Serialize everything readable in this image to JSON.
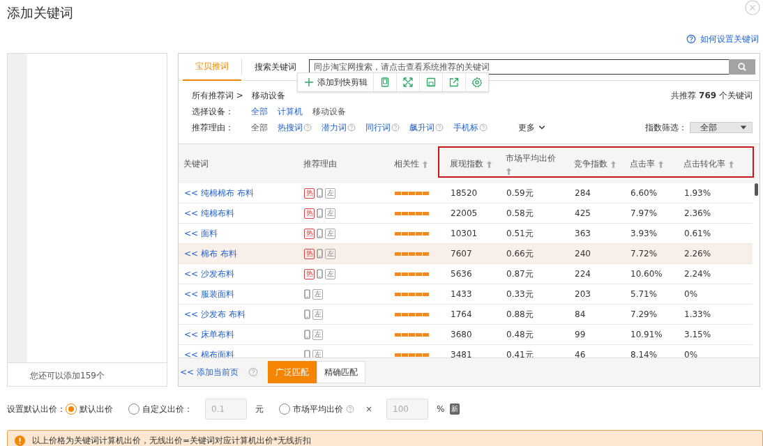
{
  "dialog": {
    "title": "添加关键词",
    "help_link": "如何设置关键词"
  },
  "left_panel": {
    "remaining_text": "您还可以添加159个"
  },
  "tabs": [
    {
      "label": "宝贝推词",
      "selected": true
    },
    {
      "label": "搜索关键词",
      "selected": false
    }
  ],
  "search": {
    "placeholder": "同步淘宝网搜索，请点击查看系统推荐的关键词"
  },
  "toolbar": {
    "add_label": "添加到快剪辑"
  },
  "breadcrumb": {
    "root": "所有推荐词 >",
    "current": "移动设备"
  },
  "total": {
    "prefix": "共推荐",
    "count": "769",
    "suffix": "个关键词"
  },
  "device_filter": {
    "label": "选择设备：",
    "options": [
      {
        "label": "全部",
        "selected": false
      },
      {
        "label": "计算机",
        "selected": false
      },
      {
        "label": "移动设备",
        "selected": true
      }
    ]
  },
  "reason_filter": {
    "label": "推荐理由：",
    "options": [
      {
        "label": "全部",
        "selected": true,
        "help": false
      },
      {
        "label": "热搜词",
        "selected": false,
        "help": true
      },
      {
        "label": "潜力词",
        "selected": false,
        "help": true
      },
      {
        "label": "同行词",
        "selected": false,
        "help": true
      },
      {
        "label": "飙升词",
        "selected": false,
        "help": true
      },
      {
        "label": "手机标",
        "selected": false,
        "help": true
      }
    ],
    "more": "更多"
  },
  "index_filter": {
    "label": "指数筛选：",
    "value": "全部"
  },
  "table": {
    "columns": [
      {
        "label": "关键词",
        "sortable": false,
        "highlighted": false
      },
      {
        "label": "推荐理由",
        "sortable": false,
        "highlighted": false
      },
      {
        "label": "相关性",
        "sortable": true,
        "highlighted": false
      },
      {
        "label": "展现指数",
        "sortable": true,
        "highlighted": true
      },
      {
        "label": "市场平均出价",
        "sortable": true,
        "highlighted": true
      },
      {
        "label": "竞争指数",
        "sortable": true,
        "highlighted": true
      },
      {
        "label": "点击率",
        "sortable": true,
        "highlighted": true
      },
      {
        "label": "点击转化率",
        "sortable": true,
        "highlighted": true
      }
    ],
    "rows": [
      {
        "keyword": "<< 纯棉棉布 布料",
        "tags": [
          {
            "kind": "hot",
            "text": "热"
          },
          {
            "kind": "mobile"
          },
          {
            "kind": "left",
            "text": "左"
          }
        ],
        "relevance": {
          "level": 1
        },
        "impressions": "18520",
        "avg_price": "0.59元",
        "competition": "284",
        "ctr": "6.60%",
        "cvr": "1.93%",
        "selected": false
      },
      {
        "keyword": "<< 纯棉布料",
        "tags": [
          {
            "kind": "hot",
            "text": "热"
          },
          {
            "kind": "mobile"
          },
          {
            "kind": "left",
            "text": "左"
          }
        ],
        "relevance": {
          "level": 1
        },
        "impressions": "22005",
        "avg_price": "0.58元",
        "competition": "425",
        "ctr": "7.97%",
        "cvr": "2.36%",
        "selected": false
      },
      {
        "keyword": "<< 面料",
        "tags": [
          {
            "kind": "hot",
            "text": "热"
          },
          {
            "kind": "mobile"
          },
          {
            "kind": "left",
            "text": "左"
          }
        ],
        "relevance": {
          "level": 1
        },
        "impressions": "10301",
        "avg_price": "0.51元",
        "competition": "363",
        "ctr": "3.93%",
        "cvr": "0.61%",
        "selected": false
      },
      {
        "keyword": "<< 棉布 布料",
        "tags": [
          {
            "kind": "hot",
            "text": "热"
          },
          {
            "kind": "mobile"
          },
          {
            "kind": "left",
            "text": "左"
          }
        ],
        "relevance": {
          "level": 1
        },
        "impressions": "7607",
        "avg_price": "0.66元",
        "competition": "240",
        "ctr": "7.72%",
        "cvr": "2.26%",
        "selected": true
      },
      {
        "keyword": "<< 沙发布料",
        "tags": [
          {
            "kind": "hot",
            "text": "热"
          },
          {
            "kind": "mobile"
          },
          {
            "kind": "left",
            "text": "左"
          }
        ],
        "relevance": {
          "level": 1
        },
        "impressions": "5636",
        "avg_price": "0.87元",
        "competition": "224",
        "ctr": "10.60%",
        "cvr": "2.24%",
        "selected": false
      },
      {
        "keyword": "<< 服装面料",
        "tags": [
          {
            "kind": "mobile"
          },
          {
            "kind": "left",
            "text": "左"
          }
        ],
        "relevance": {
          "level": 1
        },
        "impressions": "1433",
        "avg_price": "0.33元",
        "competition": "203",
        "ctr": "5.71%",
        "cvr": "0%",
        "selected": false
      },
      {
        "keyword": "<< 沙发布 布料",
        "tags": [
          {
            "kind": "mobile"
          },
          {
            "kind": "left",
            "text": "左"
          }
        ],
        "relevance": {
          "level": 1
        },
        "impressions": "1764",
        "avg_price": "0.88元",
        "competition": "84",
        "ctr": "7.29%",
        "cvr": "1.33%",
        "selected": false
      },
      {
        "keyword": "<< 床单布料",
        "tags": [
          {
            "kind": "mobile"
          },
          {
            "kind": "left",
            "text": "左"
          }
        ],
        "relevance": {
          "level": 1
        },
        "impressions": "3680",
        "avg_price": "0.48元",
        "competition": "99",
        "ctr": "10.91%",
        "cvr": "3.15%",
        "selected": false
      },
      {
        "keyword": "<< 棉布面料",
        "tags": [
          {
            "kind": "mobile"
          },
          {
            "kind": "left",
            "text": "左"
          }
        ],
        "relevance": {
          "level": 1
        },
        "impressions": "3481",
        "avg_price": "0.41元",
        "competition": "46",
        "ctr": "8.14%",
        "cvr": "0%",
        "selected": false
      }
    ]
  },
  "footer": {
    "add_page": "<< 添加当前页",
    "match_buttons": [
      {
        "label": "广泛匹配",
        "selected": true
      },
      {
        "label": "精确匹配",
        "selected": false
      }
    ]
  },
  "bid": {
    "label": "设置默认出价：",
    "options": [
      {
        "kind": "plain",
        "label": "默认出价",
        "selected": true
      },
      {
        "kind": "input",
        "label": "自定义出价：",
        "placeholder": "0.1",
        "unit": "元",
        "selected": false
      },
      {
        "kind": "market",
        "label": "市场平均出价",
        "operator": "×",
        "placeholder": "100",
        "unit": "%",
        "badge": "新",
        "selected": false
      }
    ]
  },
  "notice": {
    "text": "以上价格为关键词计算机出价，无线出价=关键词对应计算机出价*无线折扣"
  }
}
